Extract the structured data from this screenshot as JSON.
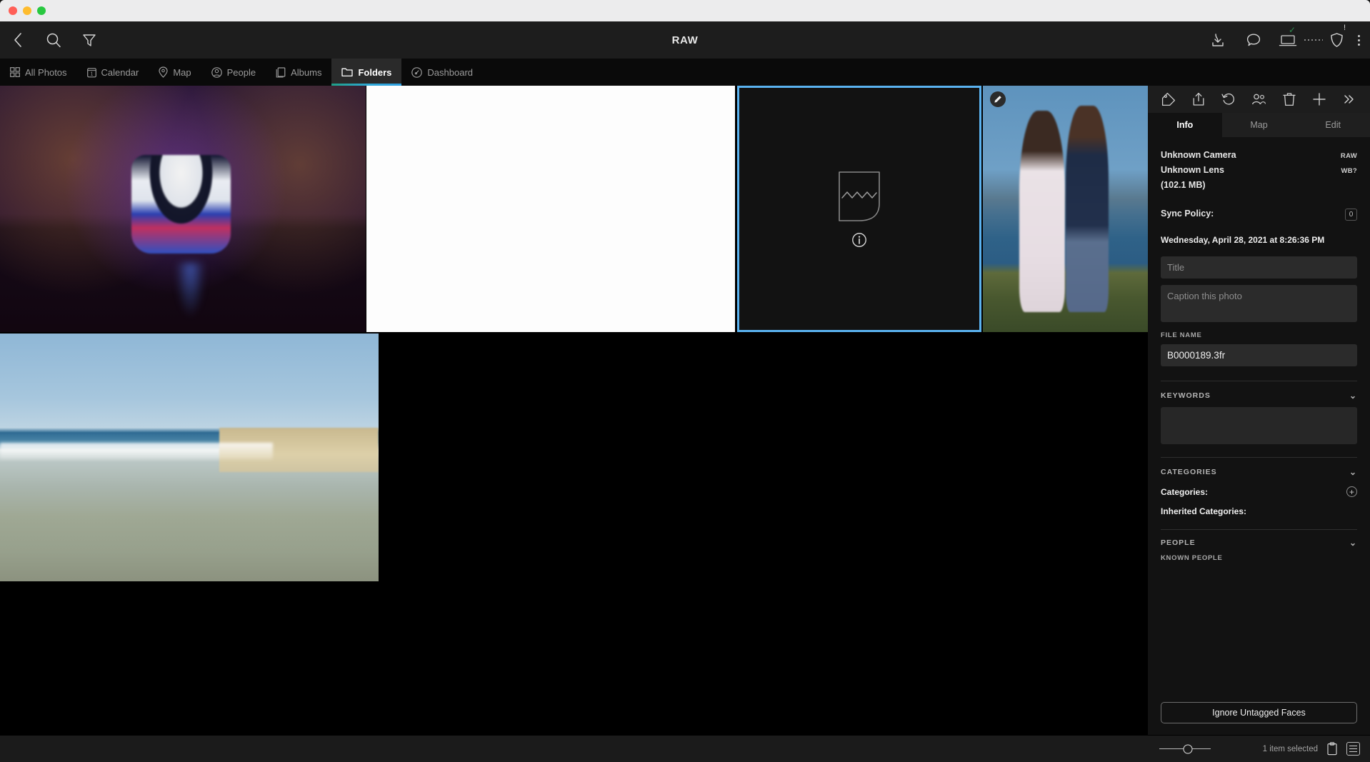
{
  "window": {
    "title": "RAW"
  },
  "toolbar": {
    "back_icon": "chevron-left-icon",
    "search_icon": "search-icon",
    "filter_icon": "filter-icon",
    "right_icons": [
      {
        "name": "import-download-icon"
      },
      {
        "name": "comment-bubble-icon"
      },
      {
        "name": "laptop-sync-icon",
        "badge": "✓"
      },
      {
        "name": "shield-warning-icon",
        "badge": "!"
      },
      {
        "name": "overflow-menu-icon"
      }
    ]
  },
  "nav": {
    "items": [
      {
        "label": "All Photos",
        "icon": "grid-icon",
        "active": false
      },
      {
        "label": "Calendar",
        "icon": "calendar-icon",
        "active": false
      },
      {
        "label": "Map",
        "icon": "map-pin-icon",
        "active": false
      },
      {
        "label": "People",
        "icon": "person-icon",
        "active": false
      },
      {
        "label": "Albums",
        "icon": "albums-icon",
        "active": false
      },
      {
        "label": "Folders",
        "icon": "folder-icon",
        "active": true
      },
      {
        "label": "Dashboard",
        "icon": "gauge-icon",
        "active": false
      }
    ]
  },
  "grid": {
    "items": [
      {
        "name": "thumbnail-toy-figure",
        "kind": "photo",
        "selected": false
      },
      {
        "name": "thumbnail-blank-white",
        "kind": "photo",
        "selected": false
      },
      {
        "name": "thumbnail-raw-placeholder",
        "kind": "placeholder",
        "selected": true
      },
      {
        "name": "thumbnail-couple-portrait",
        "kind": "photo",
        "selected": false,
        "badge_icon": "pencil-edit-icon"
      },
      {
        "name": "thumbnail-beach-shoreline",
        "kind": "photo",
        "selected": false
      }
    ]
  },
  "panel": {
    "toolbar_icons": [
      {
        "name": "tag-icon"
      },
      {
        "name": "share-upload-icon"
      },
      {
        "name": "rotate-undo-icon"
      },
      {
        "name": "faces-people-icon"
      },
      {
        "name": "trash-icon"
      },
      {
        "name": "plus-icon"
      },
      {
        "name": "expand-chevrons-icon"
      }
    ],
    "tabs": [
      {
        "label": "Info",
        "active": true
      },
      {
        "label": "Map",
        "active": false
      },
      {
        "label": "Edit",
        "active": false
      }
    ],
    "camera": "Unknown Camera",
    "camera_tag": "RAW",
    "lens": "Unknown Lens",
    "lens_tag": "WB?",
    "file_size": "(102.1 MB)",
    "sync_policy_label": "Sync Policy:",
    "sync_policy_value": "0",
    "date_taken": "Wednesday, April 28, 2021 at 8:26:36 PM",
    "title_placeholder": "Title",
    "title_value": "",
    "caption_placeholder": "Caption this photo",
    "caption_value": "",
    "file_name_label": "FILE NAME",
    "file_name_value": "B0000189.3fr",
    "keywords_header": "KEYWORDS",
    "keywords_value": "",
    "categories_header": "CATEGORIES",
    "categories_label": "Categories:",
    "inherited_categories_label": "Inherited Categories:",
    "people_header": "PEOPLE",
    "known_people_label": "KNOWN PEOPLE",
    "ignore_faces_button": "Ignore Untagged Faces"
  },
  "status": {
    "selection_text": "1 item selected",
    "clipboard_icon": "clipboard-icon",
    "list_view_icon": "list-view-icon",
    "zoom_slider_name": "thumbnail-size-slider"
  },
  "colors": {
    "accent_selection": "#5ab2f0",
    "tab_underline_start": "#1f9e86",
    "tab_underline_end": "#2f9fe0",
    "panel_bg": "#121212",
    "toolbar_bg": "#1d1d1d",
    "check_green": "#2e8b4f"
  }
}
